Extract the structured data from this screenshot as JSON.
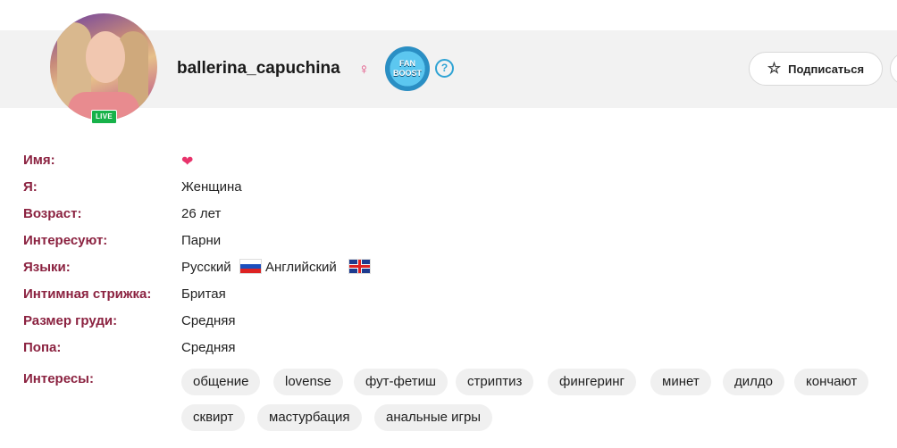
{
  "profile": {
    "username": "ballerina_capuchina",
    "live_label": "LIVE",
    "gender_symbol": "♀",
    "fanboost_line1": "FAN",
    "fanboost_line2": "BOOST",
    "help_symbol": "?",
    "subscribe_label": "Подписаться",
    "star_icon": "star-outline-icon"
  },
  "details": {
    "name_label": "Имя:",
    "name_value_icon": "heart-icon",
    "me_label": "Я:",
    "me_value": "Женщина",
    "age_label": "Возраст:",
    "age_value": "26 лет",
    "interested_label": "Интересуют:",
    "interested_value": "Парни",
    "languages_label": "Языки:",
    "languages": [
      "Русский",
      "Английский"
    ],
    "grooming_label": "Интимная стрижка:",
    "grooming_value": "Бритая",
    "breast_label": "Размер груди:",
    "breast_value": "Средняя",
    "butt_label": "Попа:",
    "butt_value": "Средняя",
    "interests_label": "Интересы:",
    "interests": [
      "общение",
      "lovense",
      "фут-фетиш",
      "стриптиз",
      "фингеринг",
      "минет",
      "дилдо",
      "кончают",
      "сквирт",
      "мастурбация",
      "анальные игры"
    ]
  },
  "colors": {
    "label": "#8b2240",
    "live_badge": "#17b24a",
    "gender": "#e0457b",
    "help": "#2fa3d4",
    "tag_bg": "#f0f0f0"
  }
}
